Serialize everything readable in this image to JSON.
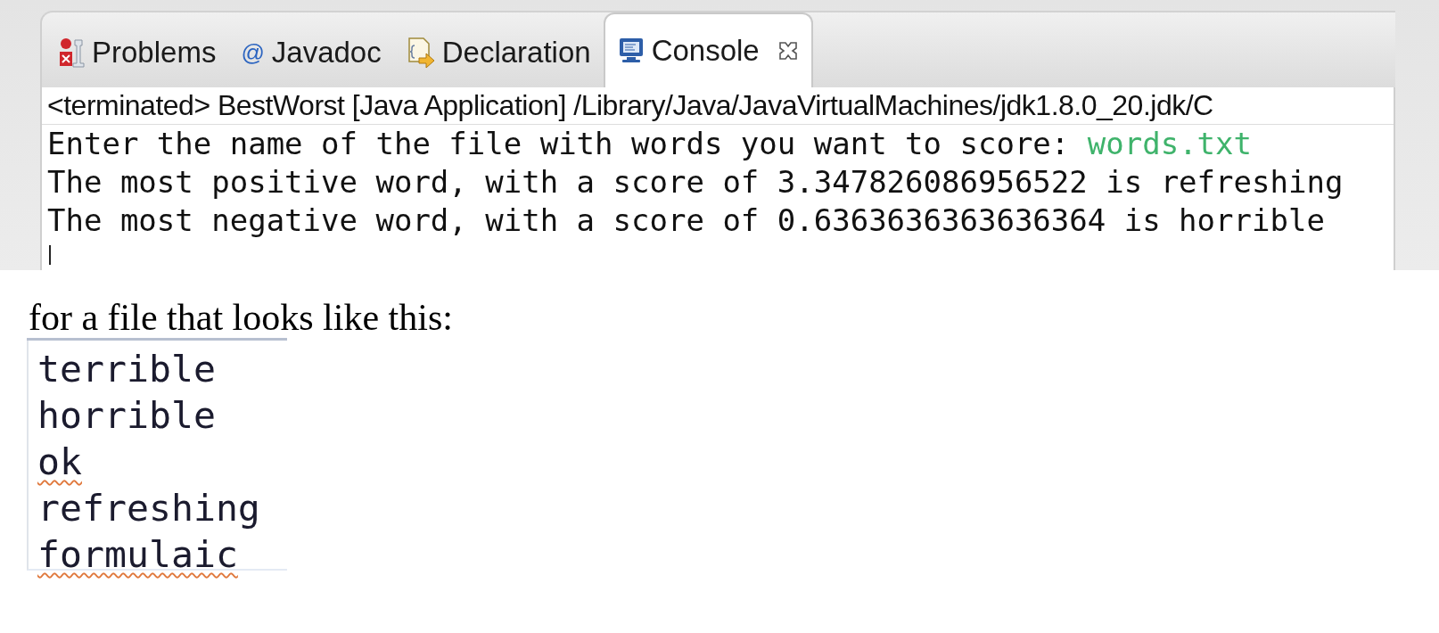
{
  "console_view": {
    "tabs": [
      {
        "label": "Problems",
        "kind": "problems",
        "selected": false,
        "closable": false
      },
      {
        "label": "Javadoc",
        "kind": "javadoc",
        "icon": "@",
        "selected": false,
        "closable": false
      },
      {
        "label": "Declaration",
        "kind": "declaration",
        "selected": false,
        "closable": false
      },
      {
        "label": "Console",
        "kind": "console",
        "selected": true,
        "closable": true
      }
    ],
    "header": "<terminated> BestWorst [Java Application] /Library/Java/JavaVirtualMachines/jdk1.8.0_20.jdk/C",
    "lines": [
      {
        "text": "Enter the name of the file with words you want to score: ",
        "input": "words.txt"
      },
      {
        "text": "The most positive word, with a score of 3.347826086956522 is refreshing"
      },
      {
        "text": "The most negative word, with a score of 0.6363636363636364 is horrible"
      }
    ]
  },
  "caption": "for a file that looks like this:",
  "file_lines": [
    {
      "text": "terrible",
      "misspelled": false
    },
    {
      "text": "horrible",
      "misspelled": false
    },
    {
      "text": "ok",
      "misspelled": true
    },
    {
      "text": "refreshing",
      "misspelled": false
    },
    {
      "text": "formulaic",
      "misspelled": true
    }
  ]
}
